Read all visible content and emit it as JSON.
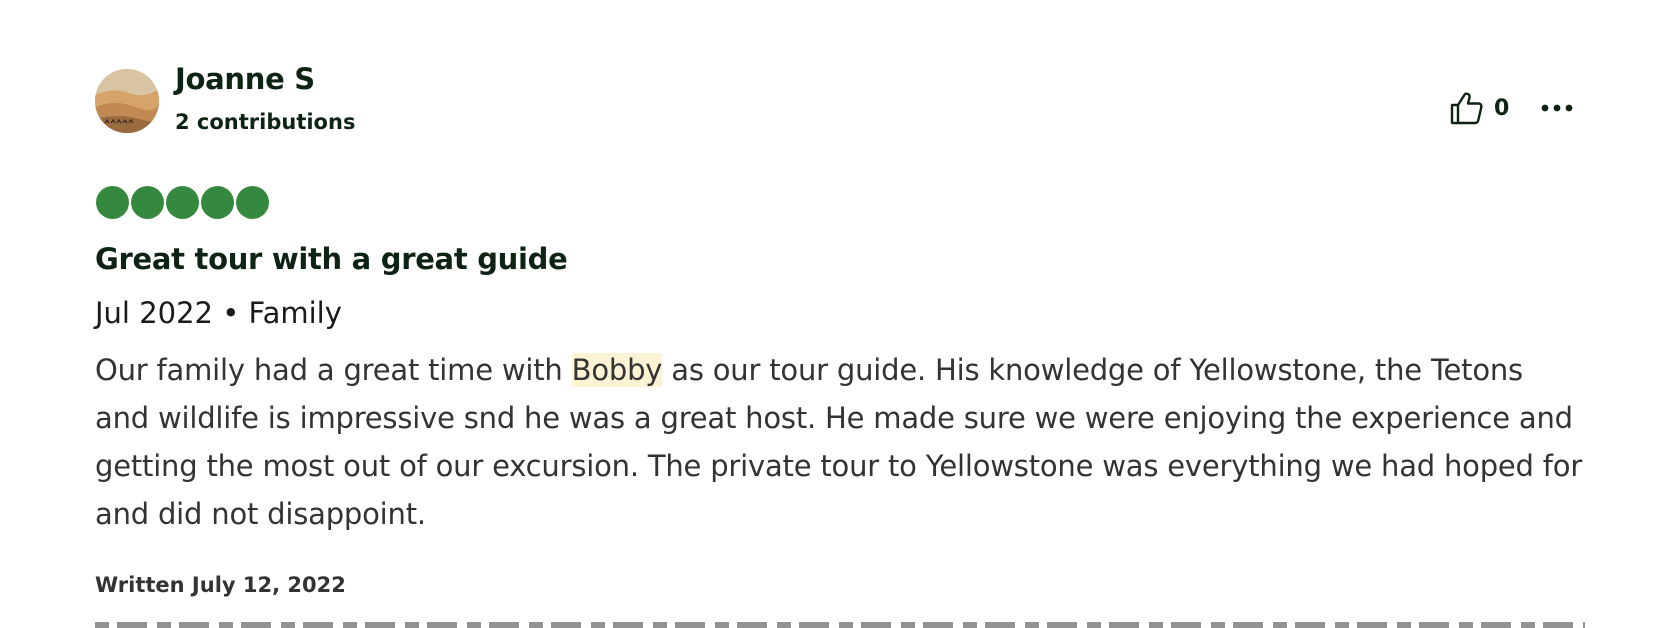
{
  "reviewer": {
    "name": "Joanne S",
    "contributions": "2 contributions"
  },
  "actions": {
    "helpful_count": "0",
    "helpful_icon": "thumbs-up-icon",
    "more_icon": "more-horizontal-icon"
  },
  "review": {
    "rating": 5,
    "rating_max": 5,
    "rating_color": "#34893e",
    "title": "Great tour with a great guide",
    "trip_meta": "Jul 2022 • Family",
    "body_before": "Our family had a great time with ",
    "body_highlight": "Bobby",
    "body_after": " as our tour guide. His knowledge of Yellowstone, the Tetons and wildlife is impressive snd he was a great host. He made sure we were enjoying the experience and getting the most out of our excursion. The private tour to Yellowstone was everything we had hoped for and did not disappoint.",
    "written_date": "Written July 12, 2022"
  },
  "colors": {
    "heading": "#0d2414",
    "body": "#333333",
    "highlight": "#fcf2d4"
  }
}
